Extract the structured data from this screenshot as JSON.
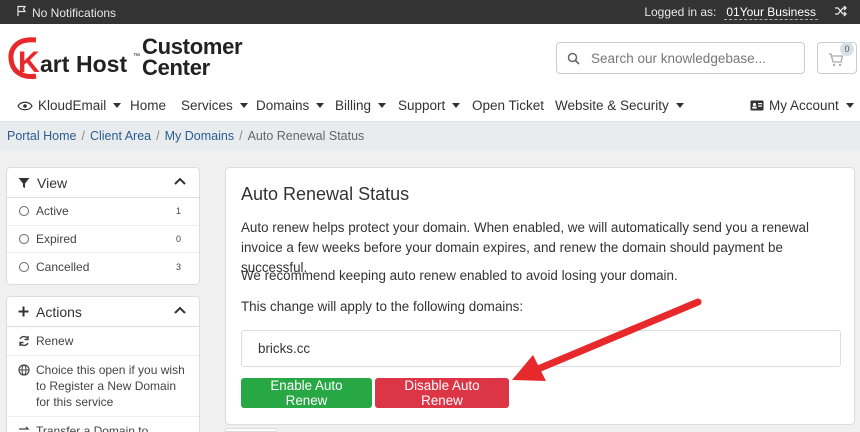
{
  "topbar": {
    "notifications": "No Notifications",
    "logged_in_label": "Logged in as:",
    "business": "01Your Business"
  },
  "header": {
    "logo_text": "KartHost",
    "title_line1": "Customer",
    "title_line2": "Center",
    "search_placeholder": "Search our knowledgebase...",
    "cart_count": "0"
  },
  "nav": {
    "items": [
      {
        "label": "KloudEmail"
      },
      {
        "label": "Home"
      },
      {
        "label": "Services"
      },
      {
        "label": "Domains"
      },
      {
        "label": "Billing"
      },
      {
        "label": "Support"
      },
      {
        "label": "Open Ticket"
      },
      {
        "label": "Website & Security"
      }
    ],
    "account": "My Account"
  },
  "breadcrumb": {
    "items": [
      "Portal Home",
      "Client Area",
      "My Domains"
    ],
    "current": "Auto Renewal Status"
  },
  "sidebar": {
    "view": {
      "title": "View",
      "items": [
        {
          "label": "Active",
          "count": "1"
        },
        {
          "label": "Expired",
          "count": "0"
        },
        {
          "label": "Cancelled",
          "count": "3"
        }
      ]
    },
    "actions": {
      "title": "Actions",
      "items": [
        {
          "label": "Renew"
        },
        {
          "label": "Choice this open if you wish to Register a New Domain for this service"
        },
        {
          "label": "Transfer a Domain to"
        }
      ]
    }
  },
  "main": {
    "title": "Auto Renewal Status",
    "para1": "Auto renew helps protect your domain. When enabled, we will automatically send you a renewal invoice a few weeks before your domain expires, and renew the domain should payment be successful.",
    "para2": "We recommend keeping auto renew enabled to avoid losing your domain.",
    "para3": "This change will apply to the following domains:",
    "domain": "bricks.cc",
    "enable_label": "Enable Auto Renew",
    "disable_label": "Disable Auto Renew"
  },
  "colors": {
    "accent_red": "#e8292c",
    "enable_green": "#28a745",
    "disable_red": "#dc3545",
    "link_blue": "#2b5d8f"
  }
}
